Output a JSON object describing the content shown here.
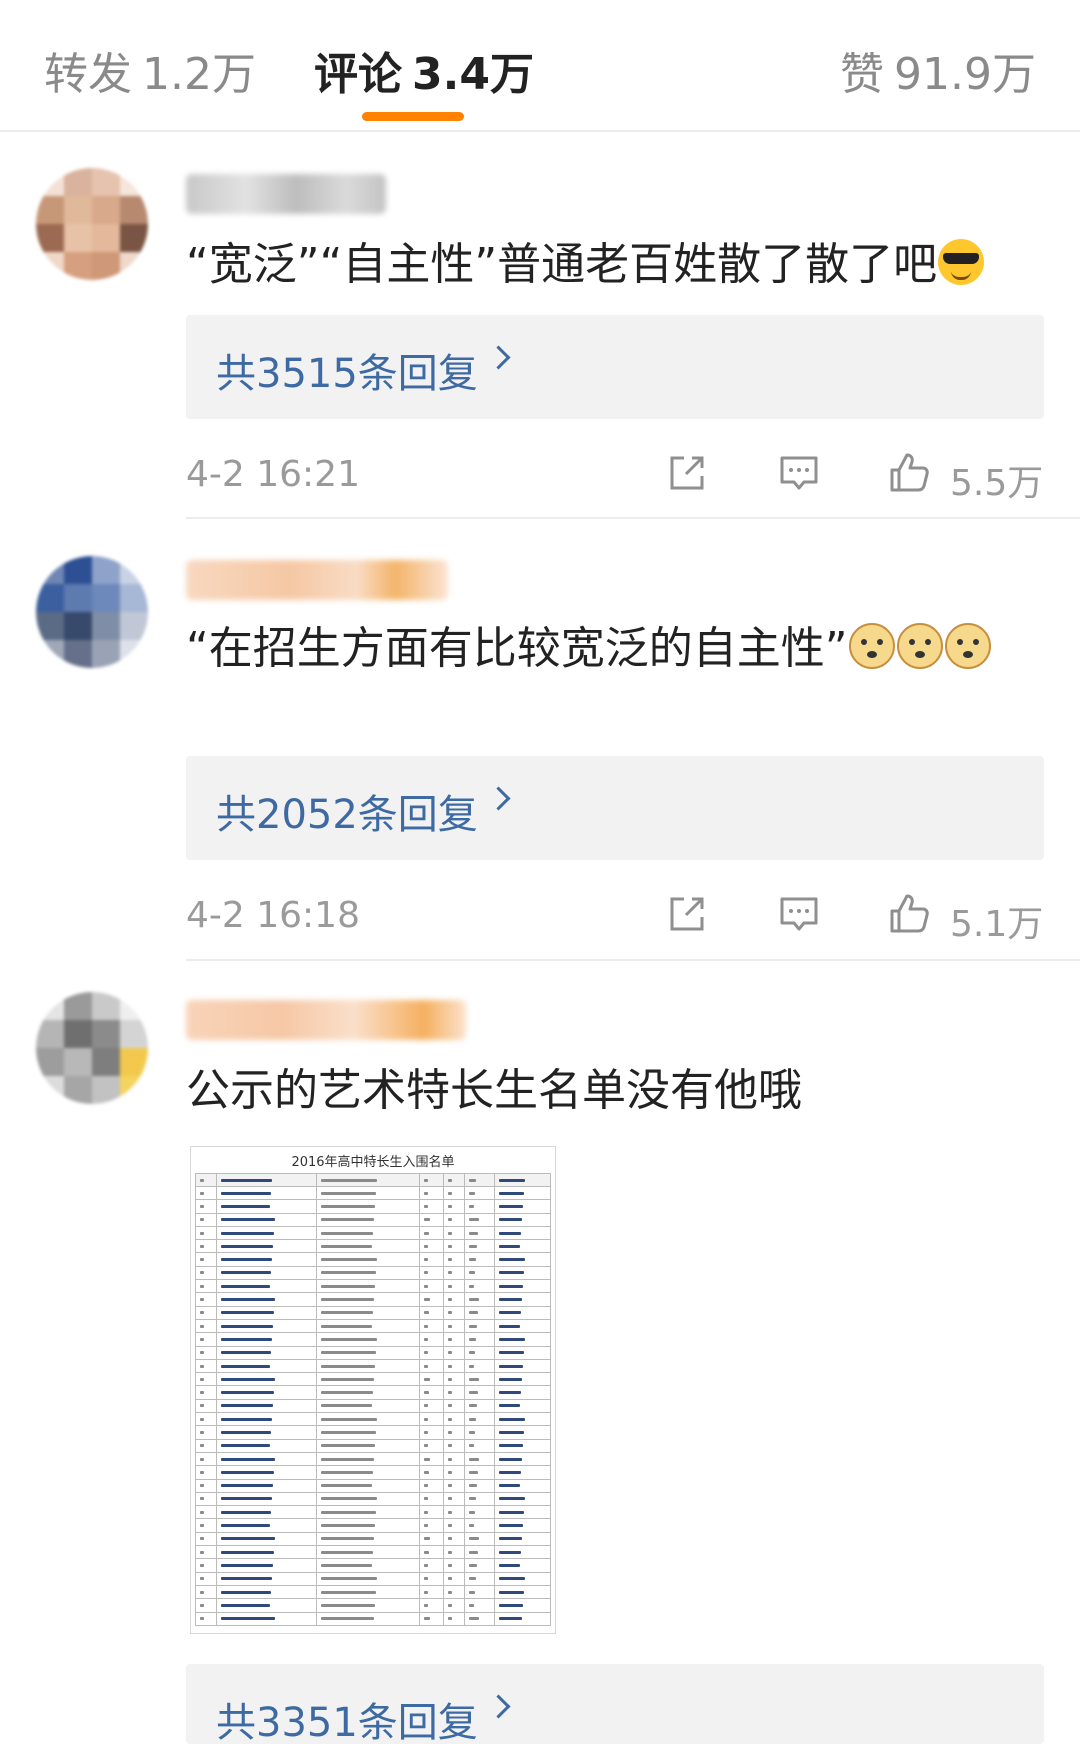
{
  "tabs": [
    {
      "label": "转发",
      "count": "1.2万"
    },
    {
      "label": "评论",
      "count": "3.4万"
    },
    {
      "label": "赞",
      "count": "91.9万"
    }
  ],
  "comments": [
    {
      "text": "“宽泛”“自主性”普通老百姓散了散了吧",
      "emojis": [
        "cool-face"
      ],
      "replies": "共3515条回复",
      "time": "4-2 16:21",
      "likes": "5.5万"
    },
    {
      "text": "“在招生方面有比较宽泛的自主性”",
      "emojis": [
        "doge",
        "doge",
        "doge"
      ],
      "replies": "共2052条回复",
      "time": "4-2 16:18",
      "likes": "5.1万"
    },
    {
      "text": "公示的艺术特长生名单没有他哦",
      "image_caption": "2016年高中特长生入围名单",
      "replies": "共3351条回复"
    }
  ],
  "colors": {
    "accent": "#ff8200",
    "link": "#3e6aa4",
    "reply_bg": "#f2f2f2",
    "meta_text": "#9a9a9a"
  }
}
